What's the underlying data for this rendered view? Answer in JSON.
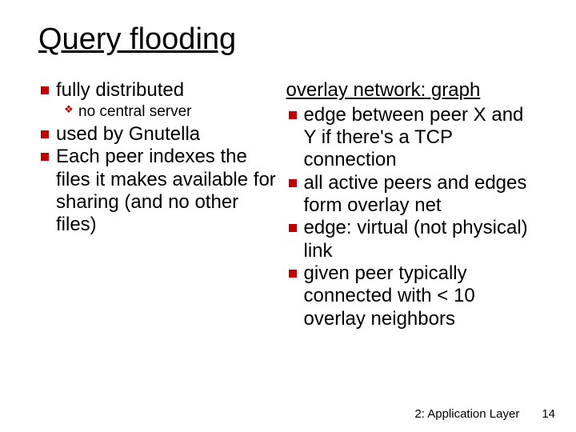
{
  "title": "Query flooding",
  "left": {
    "items": [
      {
        "text": "fully distributed",
        "sub": [
          "no central server"
        ]
      },
      {
        "text": "used by Gnutella"
      },
      {
        "text": "Each peer indexes the files it makes available for sharing (and no other files)"
      }
    ]
  },
  "right": {
    "heading": "overlay network: graph",
    "items": [
      "edge between peer X and Y if there's a TCP connection",
      "all active peers and edges form overlay net",
      "edge: virtual (not physical) link",
      "given peer typically connected with < 10 overlay neighbors"
    ]
  },
  "footer": {
    "section": "2: Application Layer",
    "page": "14"
  }
}
